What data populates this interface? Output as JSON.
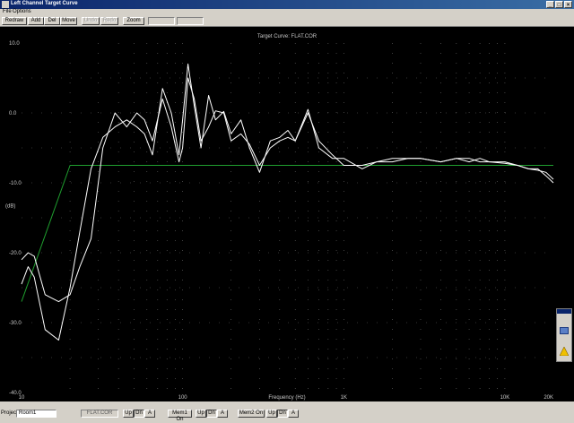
{
  "window": {
    "title": "Left Channel Target Curve"
  },
  "menu": {
    "file": "File",
    "options": "Options"
  },
  "toolbar": {
    "redraw": "Redraw",
    "add": "Add",
    "del": "Del",
    "move": "Move",
    "undo": "Undo",
    "redo": "Redo",
    "zoom": "Zoom"
  },
  "chart_data": {
    "type": "line",
    "title": "Target Curve: FLAT.COR",
    "xlabel": "Frequency (Hz)",
    "ylabel": "(dB)",
    "xscale": "log",
    "xlim": [
      10,
      20000
    ],
    "ylim": [
      -40,
      10
    ],
    "grid": "dotted",
    "x_tick_labels": [
      "10",
      "100",
      "1K",
      "10K",
      "20K"
    ],
    "y_tick_labels": [
      "10.0",
      "0.0",
      "-10.0",
      "-20.0",
      "-30.0",
      "-40.0"
    ],
    "colors": {
      "target": "#1f9f2f",
      "measured": "#ffffff"
    },
    "series": [
      {
        "role": "target",
        "x": [
          10,
          20,
          20000
        ],
        "y": [
          -27,
          -7.5,
          -7.5
        ]
      },
      {
        "role": "measured",
        "x": [
          10,
          11,
          12,
          14,
          17,
          20,
          23,
          27,
          32,
          38,
          45,
          52,
          58,
          65,
          75,
          85,
          95,
          100,
          108,
          118,
          130,
          145,
          160,
          180,
          200,
          230,
          260,
          300,
          350,
          400,
          450,
          500,
          600,
          700,
          850,
          1000,
          1300,
          1600,
          2000,
          2500,
          3000,
          4000,
          5000,
          6000,
          7000,
          8000,
          10000,
          12000,
          14000,
          16000,
          18000,
          20000
        ],
        "y": [
          -24.5,
          -22,
          -23.5,
          -31,
          -32.5,
          -25,
          -17,
          -8,
          -3.5,
          -2,
          -1,
          -2,
          -3,
          -6,
          3.5,
          0,
          -6,
          -1,
          7,
          1,
          -5,
          2.5,
          -1,
          0.2,
          -3,
          -1,
          -5,
          -8.5,
          -4,
          -3.5,
          -2.5,
          -4,
          0.5,
          -5,
          -6.5,
          -6.5,
          -8,
          -7,
          -7,
          -6.5,
          -6.5,
          -7,
          -6.5,
          -6.5,
          -7,
          -7,
          -7,
          -7.5,
          -8,
          -8,
          -9,
          -10
        ]
      },
      {
        "role": "measured",
        "x": [
          10,
          11,
          12,
          14,
          17,
          20,
          23,
          27,
          32,
          38,
          45,
          52,
          58,
          65,
          75,
          85,
          95,
          100,
          108,
          118,
          130,
          145,
          160,
          180,
          200,
          230,
          260,
          300,
          350,
          400,
          450,
          500,
          600,
          700,
          850,
          1000,
          1300,
          1600,
          2000,
          2500,
          3000,
          4000,
          5000,
          6000,
          7000,
          8000,
          10000,
          12000,
          14000,
          16000,
          18000,
          20000
        ],
        "y": [
          -21,
          -20,
          -20.5,
          -26,
          -27,
          -26,
          -22,
          -18,
          -5,
          0,
          -2,
          0,
          -1,
          -4,
          2,
          -2,
          -7,
          -5,
          5,
          2,
          -4,
          -2,
          0.3,
          0,
          -4,
          -3,
          -4.5,
          -7.5,
          -5,
          -4,
          -3.5,
          -4,
          0,
          -4,
          -6,
          -7.5,
          -7.5,
          -7,
          -6.5,
          -6.5,
          -6.5,
          -7,
          -6.5,
          -7,
          -6.5,
          -7,
          -7.2,
          -7.5,
          -8,
          -8.2,
          -8.5,
          -9.5
        ]
      }
    ]
  },
  "statusbar": {
    "project_label": "Project:",
    "project_value": "Room1",
    "target_file": "FLAT.COR",
    "up": "Up",
    "dn": "Dn",
    "a": "A",
    "mem1": "Mem1 On",
    "mem2": "Mem2 On"
  }
}
